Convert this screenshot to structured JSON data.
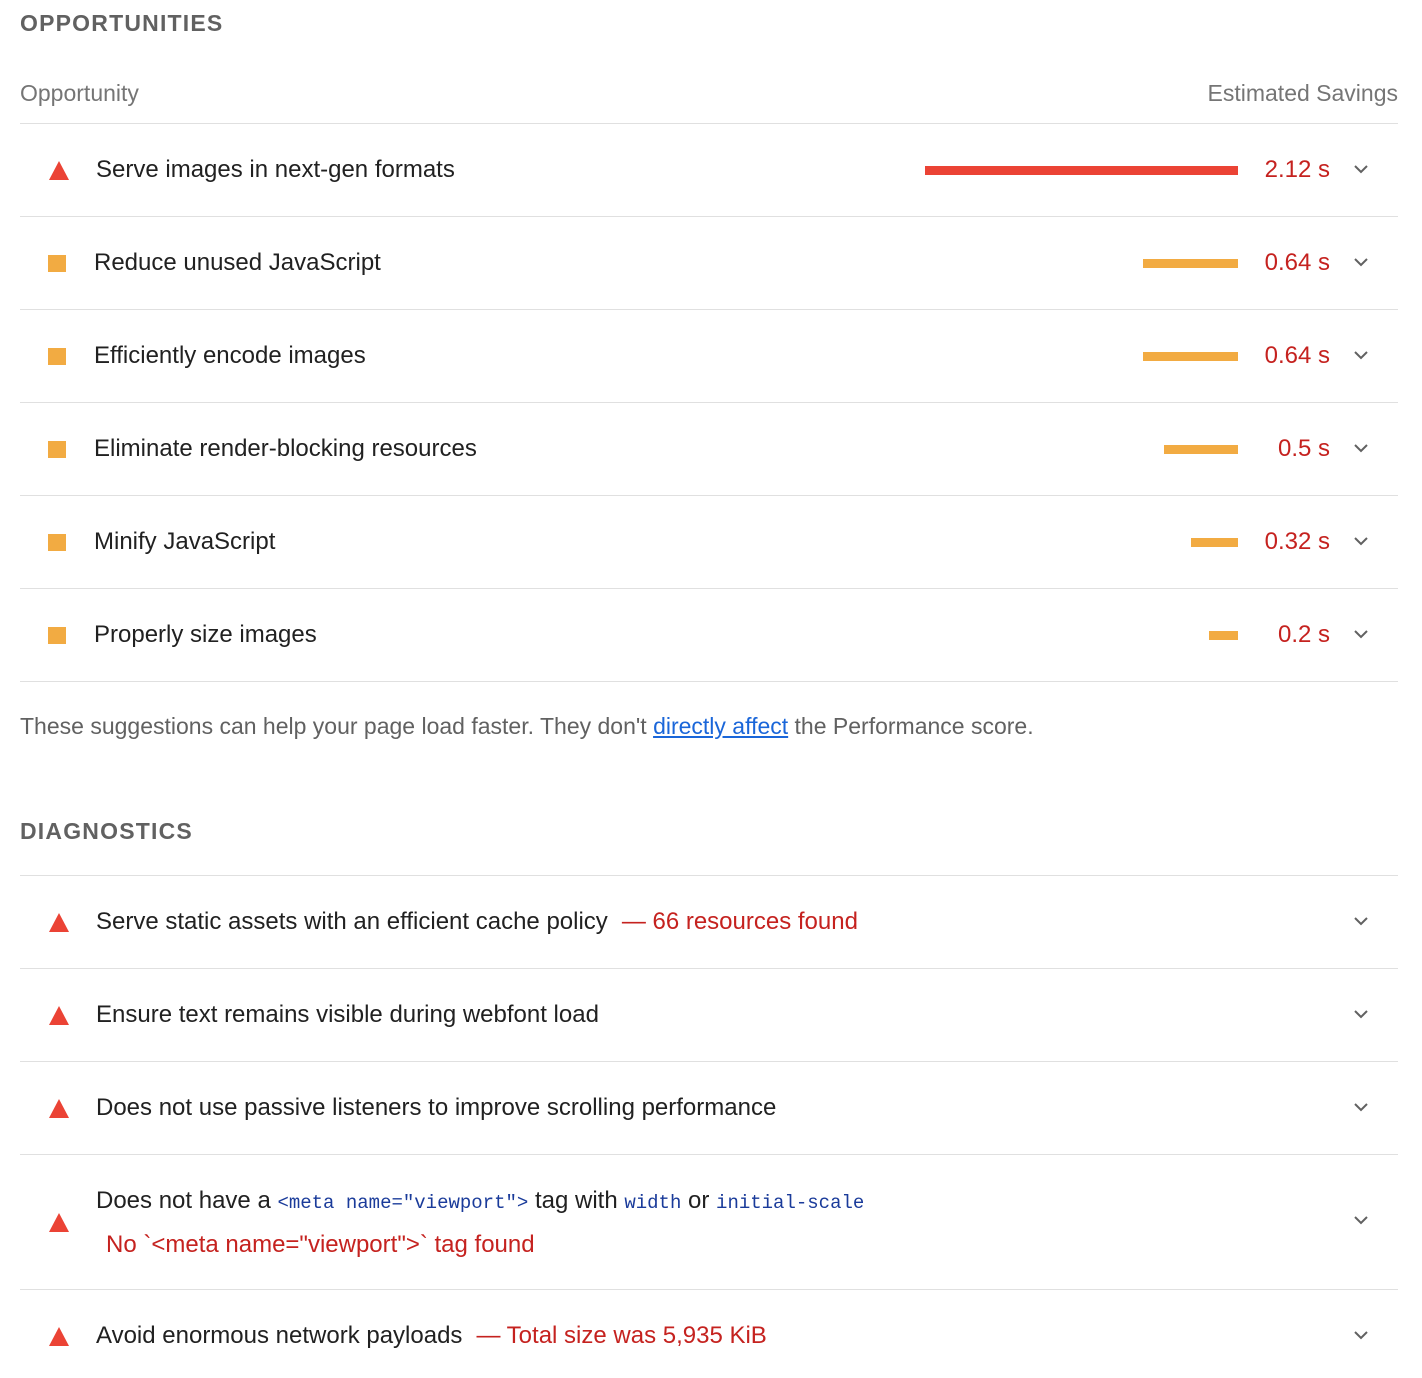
{
  "opportunities": {
    "heading": "OPPORTUNITIES",
    "col_left": "Opportunity",
    "col_right": "Estimated Savings",
    "items": [
      {
        "label": "Serve images in next-gen formats",
        "savings": "2.12 s",
        "rating": "fail",
        "bar_fraction": 1.0
      },
      {
        "label": "Reduce unused JavaScript",
        "savings": "0.64 s",
        "rating": "average",
        "bar_fraction": 0.302
      },
      {
        "label": "Efficiently encode images",
        "savings": "0.64 s",
        "rating": "average",
        "bar_fraction": 0.302
      },
      {
        "label": "Eliminate render-blocking resources",
        "savings": "0.5 s",
        "rating": "average",
        "bar_fraction": 0.236
      },
      {
        "label": "Minify JavaScript",
        "savings": "0.32 s",
        "rating": "average",
        "bar_fraction": 0.151
      },
      {
        "label": "Properly size images",
        "savings": "0.2 s",
        "rating": "average",
        "bar_fraction": 0.094
      }
    ],
    "note_before": "These suggestions can help your page load faster. They don't ",
    "note_link": "directly affect",
    "note_after": " the Performance score."
  },
  "diagnostics": {
    "heading": "DIAGNOSTICS",
    "items": [
      {
        "label": "Serve static assets with an efficient cache policy",
        "display": "— 66 resources found",
        "rating": "fail"
      },
      {
        "label": "Ensure text remains visible during webfont load",
        "rating": "fail"
      },
      {
        "label": "Does not use passive listeners to improve scrolling performance",
        "rating": "fail"
      },
      {
        "label_part1": "Does not have a ",
        "code1": "<meta name=\"viewport\">",
        "label_part2": " tag with ",
        "code2": "width",
        "label_part3": " or ",
        "code3": "initial-scale",
        "subtext": "No `<meta name=\"viewport\">` tag found",
        "rating": "fail"
      },
      {
        "label": "Avoid enormous network payloads",
        "display": "— Total size was 5,935 KiB",
        "rating": "fail"
      }
    ]
  },
  "colors": {
    "fail": "#eb4335",
    "average": "#f2ab42",
    "savings_text": "#c5221f",
    "link": "#1a66d9",
    "code": "#1a3b9a"
  },
  "icons": {
    "fail": "red-triangle-icon",
    "average": "orange-square-icon",
    "expand": "chevron-down-icon"
  }
}
